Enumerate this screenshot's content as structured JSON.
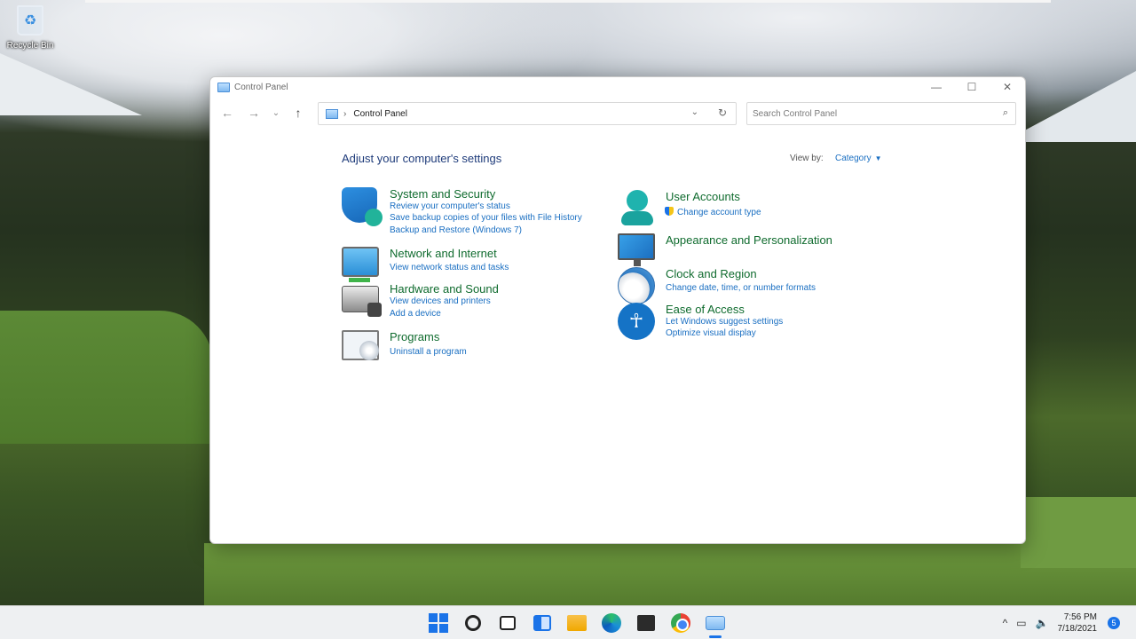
{
  "desktop": {
    "recycle_bin_label": "Recycle Bin"
  },
  "window": {
    "title": "Control Panel",
    "controls": {
      "minimize": "—",
      "maximize": "☐",
      "close": "✕"
    }
  },
  "navbar": {
    "back": "←",
    "forward": "→",
    "recent": "⌄",
    "up": "↑",
    "address_separator": "›",
    "address_text": "Control Panel",
    "address_dropdown": "⌄",
    "refresh": "↻",
    "search_placeholder": "Search Control Panel",
    "search_icon": "⌕"
  },
  "content": {
    "heading": "Adjust your computer's settings",
    "view_by_label": "View by:",
    "view_by_value": "Category",
    "view_by_arrow": "▼",
    "left_categories": [
      {
        "title": "System and Security",
        "links": [
          "Review your computer's status",
          "Save backup copies of your files with File History",
          "Backup and Restore (Windows 7)"
        ]
      },
      {
        "title": "Network and Internet",
        "links": [
          "View network status and tasks"
        ]
      },
      {
        "title": "Hardware and Sound",
        "links": [
          "View devices and printers",
          "Add a device"
        ]
      },
      {
        "title": "Programs",
        "links": [
          "Uninstall a program"
        ]
      }
    ],
    "right_categories": [
      {
        "title": "User Accounts",
        "links": [
          "Change account type"
        ]
      },
      {
        "title": "Appearance and Personalization",
        "links": []
      },
      {
        "title": "Clock and Region",
        "links": [
          "Change date, time, or number formats"
        ]
      },
      {
        "title": "Ease of Access",
        "links": [
          "Let Windows suggest settings",
          "Optimize visual display"
        ]
      }
    ]
  },
  "taskbar": {
    "icons": [
      "start-icon",
      "search-icon",
      "task-view-icon",
      "widgets-icon",
      "file-explorer-icon",
      "edge-icon",
      "store-icon",
      "chrome-icon",
      "control-panel-icon"
    ],
    "tray": {
      "chevron": "^",
      "network": "▭",
      "volume": "🔈",
      "time": "7:56 PM",
      "date": "7/18/2021",
      "notification_count": "5"
    },
    "accent": "#1a73e8"
  },
  "colors": {
    "heading": "#1e3b7a",
    "category_title": "#0f6b2e",
    "link": "#1a6fc2"
  }
}
